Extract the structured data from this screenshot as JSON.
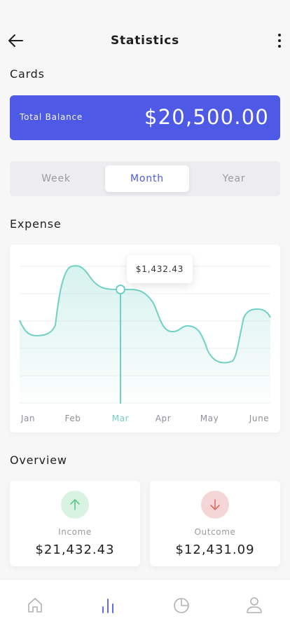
{
  "header": {
    "title": "Statistics"
  },
  "cards": {
    "section_title": "Cards",
    "label": "Total Balance",
    "value": "$20,500.00"
  },
  "tabs": [
    {
      "label": "Week"
    },
    {
      "label": "Month"
    },
    {
      "label": "Year"
    }
  ],
  "selected_tab": "Month",
  "expense": {
    "section_title": "Expense",
    "tooltip": "$1,432.43"
  },
  "chart_data": {
    "type": "area",
    "categories": [
      "Jan",
      "Feb",
      "Mar",
      "Apr",
      "May",
      "June"
    ],
    "selected_category": "Mar",
    "selected_value": "$1,432.43",
    "grid": true,
    "series": [
      {
        "color": "#6fd1c4"
      }
    ]
  },
  "overview": {
    "section_title": "Overview",
    "income": {
      "label": "Income",
      "value": "$21,432.43",
      "icon": "arrow-up-icon",
      "color": "#5fc98a"
    },
    "outcome": {
      "label": "Outcome",
      "value": "$12,431.09",
      "icon": "arrow-down-icon",
      "color": "#e06b6b"
    }
  },
  "nav": [
    {
      "icon": "home-icon"
    },
    {
      "icon": "stats-icon"
    },
    {
      "icon": "pie-chart-icon"
    },
    {
      "icon": "profile-icon"
    }
  ],
  "colors": {
    "accent": "#4e5ae6",
    "chart": "#6fd1c4"
  }
}
